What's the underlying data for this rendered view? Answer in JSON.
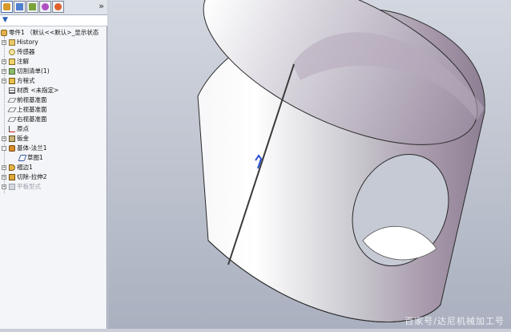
{
  "feature_manager": {
    "tabs": [
      {
        "name": "feature-tree-tab",
        "color": "#d89a2b"
      },
      {
        "name": "property-tab",
        "color": "#4f7fcf"
      },
      {
        "name": "configuration-tab",
        "color": "#7aa33a"
      },
      {
        "name": "dimxpert-tab",
        "color": "#b04fc4"
      },
      {
        "name": "display-tab",
        "color": "#e0602b"
      }
    ],
    "expand_glyph": "»",
    "filter_glyph": "▼",
    "rows": [
      {
        "label": "零件1 （默认<<默认>_显示状态",
        "icon": "part-icon",
        "expander": ""
      },
      {
        "label": "History",
        "icon": "history-icon",
        "expander": "+"
      },
      {
        "label": "传感器",
        "icon": "sensor-icon",
        "expander": ""
      },
      {
        "label": "注解",
        "icon": "annotation-icon",
        "expander": "+"
      },
      {
        "label": "切割清单(1)",
        "icon": "cut-list-icon",
        "expander": "+"
      },
      {
        "label": "方程式",
        "icon": "equation-icon",
        "expander": "+"
      },
      {
        "label": "材质 <未指定>",
        "icon": "material-icon",
        "expander": ""
      },
      {
        "label": "前视基准面",
        "icon": "plane-icon",
        "expander": ""
      },
      {
        "label": "上视基准面",
        "icon": "plane-icon",
        "expander": ""
      },
      {
        "label": "右视基准面",
        "icon": "plane-icon",
        "expander": ""
      },
      {
        "label": "原点",
        "icon": "origin-icon",
        "expander": ""
      },
      {
        "label": "钣金",
        "icon": "sheet-metal-icon",
        "expander": "+"
      },
      {
        "label": "基体-法兰1",
        "icon": "base-flange-icon",
        "expander": "-"
      },
      {
        "label": "草图1",
        "icon": "sketch-icon",
        "expander": ""
      },
      {
        "label": "褶边1",
        "icon": "hem-icon",
        "expander": "+"
      },
      {
        "label": "切除-拉伸2",
        "icon": "cut-extrude-icon",
        "expander": "+"
      },
      {
        "label": "平板型式",
        "icon": "flat-pattern-icon",
        "expander": "+"
      }
    ]
  },
  "watermark": "百家号/达尼机械加工号",
  "colors": {
    "viewport_top": "#d3d7e0",
    "viewport_bottom": "#aab0bf",
    "model_light": "#ffffff",
    "model_mid": "#b9b9c2",
    "model_dark": "#8d7f93"
  }
}
